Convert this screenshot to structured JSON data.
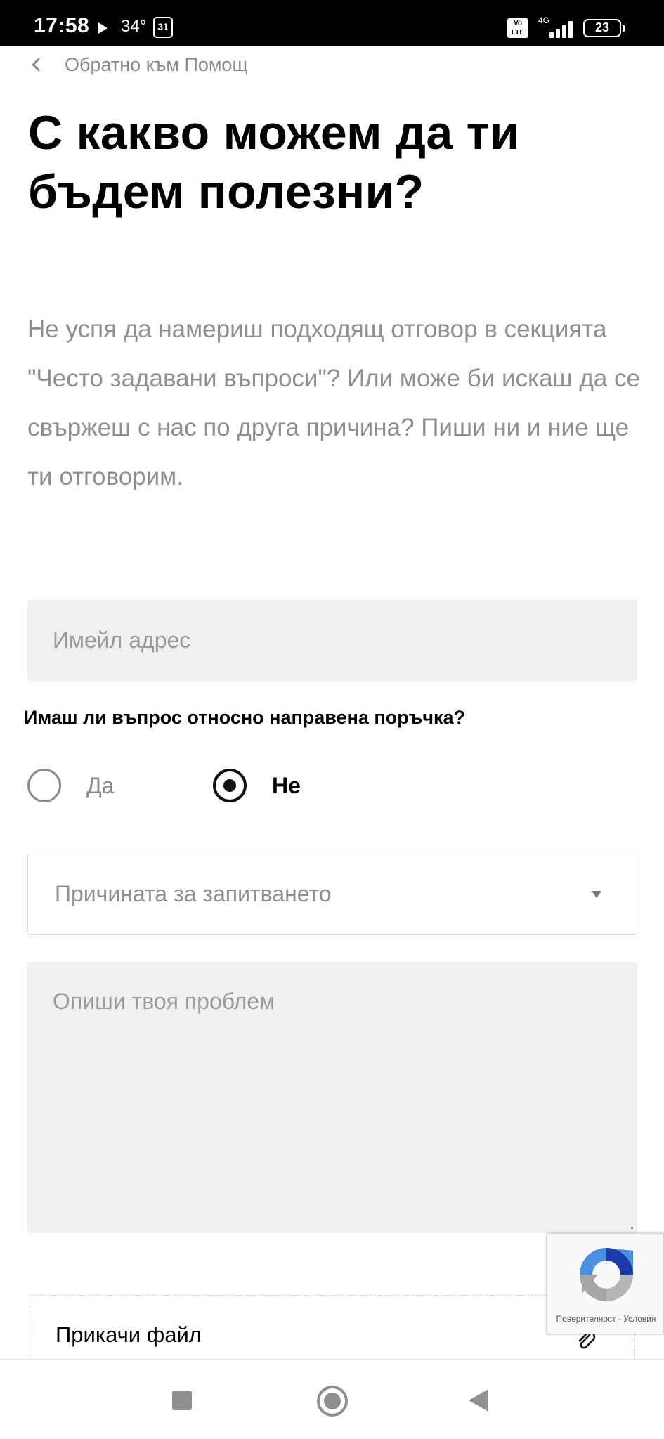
{
  "status_bar": {
    "time": "17:58",
    "temperature": "34°",
    "calendar_day": "31",
    "volte": "Vo LTE",
    "network": "4G",
    "battery": "23"
  },
  "header": {
    "back_label": "Обратно към Помощ",
    "title": "С какво можем да ти бъдем полезни?",
    "intro": "Не успя да намериш подходящ отговор в секцията \"Често задавани въпроси\"? Или може би искаш да се свържеш с нас по друга причина? Пиши ни и ние ще ти отговорим."
  },
  "form": {
    "email": {
      "placeholder": "Имейл адрес",
      "value": ""
    },
    "order_question": {
      "label": "Имаш ли въпрос относно направена поръчка?",
      "options": [
        "Да",
        "Не"
      ],
      "selected": "Не"
    },
    "reason_select": {
      "placeholder": "Причината за запитването"
    },
    "description": {
      "placeholder": "Опиши твоя проблем",
      "value": ""
    },
    "attach_label": "Прикачи файл"
  },
  "recaptcha": {
    "links": "Поверителност - Условия"
  },
  "navbar": {
    "buttons": [
      "recent-apps",
      "home",
      "back"
    ]
  },
  "colors": {
    "accent": "#000000",
    "muted_text": "#8f8f8f",
    "field_bg": "#f0f0f0",
    "statusbar_bg": "#000000"
  }
}
